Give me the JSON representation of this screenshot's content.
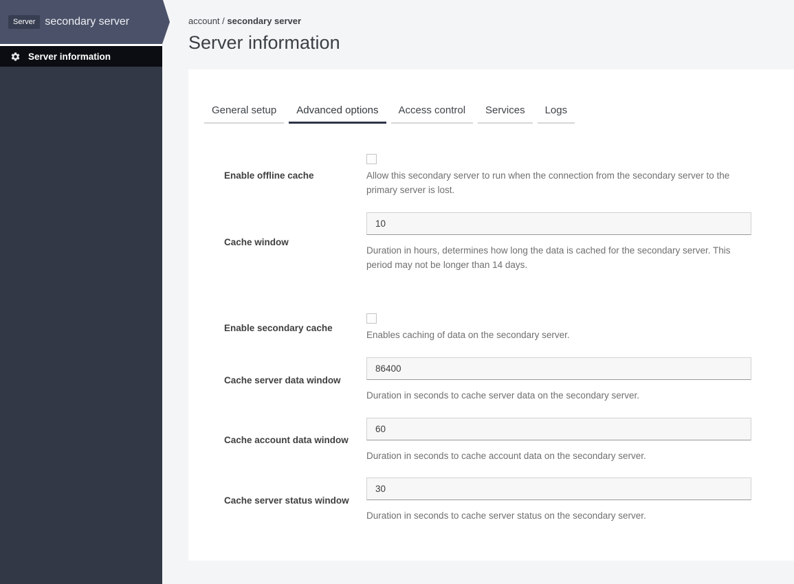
{
  "sidebar": {
    "badge": "Server",
    "title": "secondary server",
    "menu_item": "Server information"
  },
  "breadcrumb": {
    "parent": "account",
    "separator": " / ",
    "current": "secondary server"
  },
  "page_title": "Server information",
  "tabs": [
    {
      "label": "General setup",
      "active": false
    },
    {
      "label": "Advanced options",
      "active": true
    },
    {
      "label": "Access control",
      "active": false
    },
    {
      "label": "Services",
      "active": false
    },
    {
      "label": "Logs",
      "active": false
    }
  ],
  "form": {
    "fields": [
      {
        "label": "Enable offline cache",
        "type": "checkbox",
        "checked": false,
        "help": "Allow this secondary server to run when the connection from the secondary server to the primary server is lost."
      },
      {
        "label": "Cache window",
        "type": "text",
        "value": "10",
        "help": "Duration in hours, determines how long the data is cached for the secondary server. This period may not be longer than 14 days.",
        "gap_after": true
      },
      {
        "label": "Enable secondary cache",
        "type": "checkbox",
        "checked": false,
        "help": "Enables caching of data on the secondary server."
      },
      {
        "label": "Cache server data window",
        "type": "text",
        "value": "86400",
        "help": "Duration in seconds to cache server data on the secondary server."
      },
      {
        "label": "Cache account data window",
        "type": "text",
        "value": "60",
        "help": "Duration in seconds to cache account data on the secondary server."
      },
      {
        "label": "Cache server status window",
        "type": "text",
        "value": "30",
        "help": "Duration in seconds to cache server status on the secondary server."
      }
    ]
  },
  "icons": {
    "menu_icon": "gear-icon"
  },
  "colors": {
    "sidebar_header": "#4b5168",
    "sidebar_body": "#323846",
    "sidebar_badge": "#383e52",
    "menu_bar": "#0b0d12",
    "page_background": "#f4f5f7",
    "card_background": "#ffffff",
    "active_tab_underline": "#2e3448",
    "inactive_tab_underline": "#d6d6d6",
    "help_text": "#6f6f6f"
  }
}
